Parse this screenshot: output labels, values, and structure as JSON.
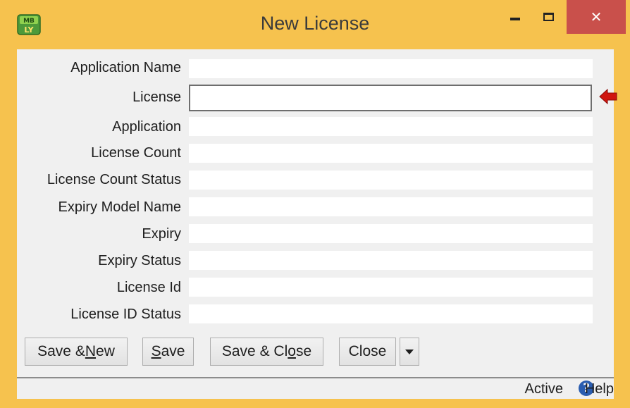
{
  "window": {
    "title": "New License",
    "icon": "mbly-app-icon",
    "controls": {
      "minimize": "minimize-icon",
      "maximize": "maximize-icon",
      "close": "close-icon",
      "close_glyph": "✕"
    }
  },
  "form": {
    "fields": [
      {
        "label": "Application Name",
        "value": ""
      },
      {
        "label": "License",
        "value": ""
      },
      {
        "label": "Application",
        "value": ""
      },
      {
        "label": "License Count",
        "value": ""
      },
      {
        "label": "License Count Status",
        "value": ""
      },
      {
        "label": "Expiry Model Name",
        "value": ""
      },
      {
        "label": "Expiry",
        "value": ""
      },
      {
        "label": "Expiry Status",
        "value": ""
      },
      {
        "label": "License Id",
        "value": ""
      },
      {
        "label": "License ID Status",
        "value": ""
      }
    ],
    "required_indicator": "red-arrow-left-icon"
  },
  "buttons": {
    "save_new": {
      "before": "Save & ",
      "accel": "N",
      "after": "ew"
    },
    "save": {
      "before": "",
      "accel": "S",
      "after": "ave"
    },
    "save_close": {
      "before": "Save & Cl",
      "accel": "o",
      "after": "se"
    },
    "close": "Close",
    "dropdown": "chevron-down-icon"
  },
  "statusbar": {
    "status": "Active",
    "help_label": "Help",
    "help_glyph": "?"
  },
  "colors": {
    "window_frame": "#f6c24e",
    "close_button": "#c9504b",
    "client_bg": "#f0f0f0",
    "required_arrow": "#d0150f",
    "help_icon": "#2a5db0"
  }
}
